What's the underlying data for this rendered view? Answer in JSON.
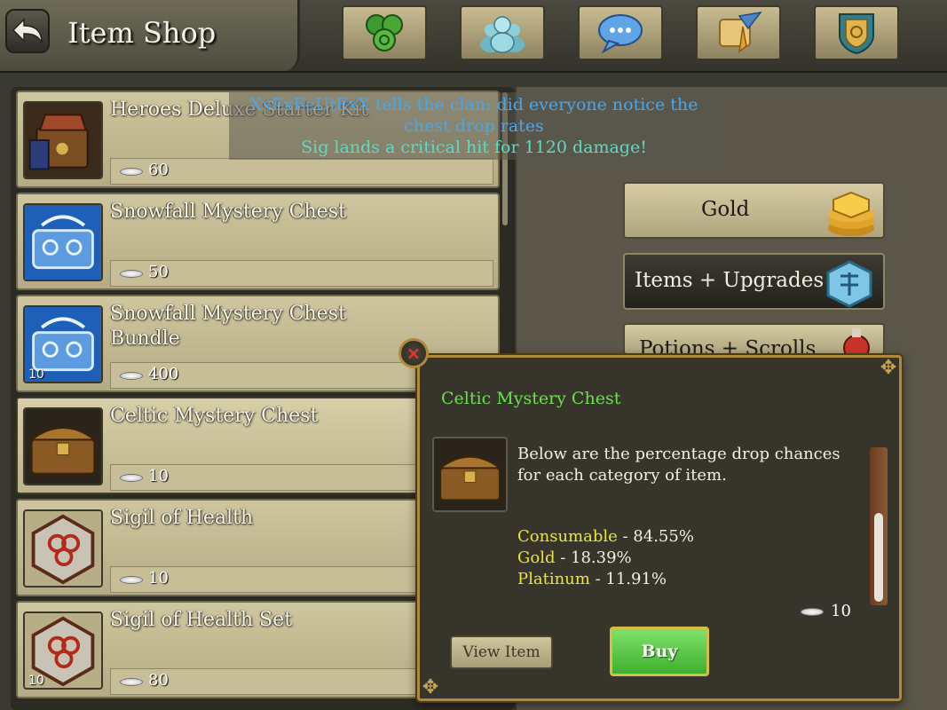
{
  "header": {
    "title": "Item Shop",
    "nav": [
      {
        "icon": "triskele-icon"
      },
      {
        "icon": "clan-icon"
      },
      {
        "icon": "chat-bubble-icon"
      },
      {
        "icon": "quest-scroll-icon"
      },
      {
        "icon": "shield-emblem-icon"
      }
    ]
  },
  "chat": {
    "line1": "XxExEcUtExX tells the clan: did everyone notice the",
    "line2": "chest drop rates",
    "line3": "Sig lands a critical hit for 1120 damage!"
  },
  "items": [
    {
      "name": "Heroes Deluxe Starter Kit",
      "price": "60",
      "badge": "",
      "icon": "starter-kit-icon"
    },
    {
      "name": "Snowfall Mystery Chest",
      "price": "50",
      "badge": "",
      "icon": "snowfall-chest-icon"
    },
    {
      "name": "Snowfall Mystery Chest Bundle",
      "price": "400",
      "badge": "10",
      "icon": "snowfall-chest-icon"
    },
    {
      "name": "Celtic Mystery Chest",
      "price": "10",
      "badge": "",
      "icon": "celtic-chest-icon"
    },
    {
      "name": "Sigil of Health",
      "price": "10",
      "badge": "",
      "icon": "sigil-icon"
    },
    {
      "name": "Sigil of Health Set",
      "price": "80",
      "badge": "10",
      "icon": "sigil-icon"
    }
  ],
  "categories": [
    {
      "label": "Gold",
      "icon": "gold-stack-icon"
    },
    {
      "label": "Items + Upgrades",
      "icon": "rune-stone-icon"
    },
    {
      "label": "Potions + Scrolls",
      "icon": "potion-icon"
    }
  ],
  "popup": {
    "title": "Celtic Mystery Chest",
    "description": "Below are the percentage drop chances for each category of item.",
    "drops": [
      {
        "name": "Consumable",
        "value": "84.55%"
      },
      {
        "name": "Gold",
        "value": "18.39%"
      },
      {
        "name": "Platinum",
        "value": "11.91%"
      }
    ],
    "price": "10",
    "view_label": "View Item",
    "buy_label": "Buy",
    "close": "×"
  },
  "colors": {
    "popup_title": "#69e24d",
    "drop_name": "#ece53a",
    "chat_clan": "#46a7ef",
    "chat_combat": "#60d9c2",
    "buy_button": "#4fbf3b"
  }
}
